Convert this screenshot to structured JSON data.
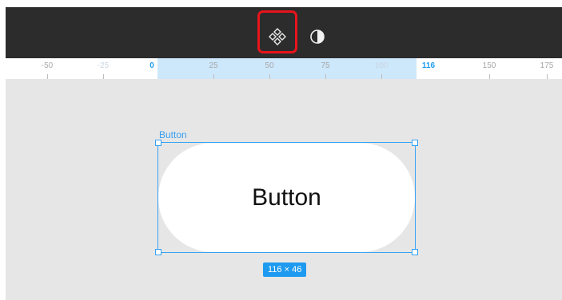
{
  "toolbar": {
    "components_icon": "components-diamond-icon",
    "theme_icon": "contrast-half-moon-icon"
  },
  "ruler": {
    "ticks": [
      "-50",
      "-25",
      "0",
      "25",
      "50",
      "75",
      "100",
      "116",
      "150",
      "175"
    ]
  },
  "canvas": {
    "layer_name": "Button",
    "button_label": "Button",
    "size_badge": "116 × 46"
  },
  "colors": {
    "toolbar_bg": "#2c2c2c",
    "canvas_bg": "#e6e6e6",
    "selection": "#35a2f4",
    "highlight": "#e8141b",
    "ruler_selection": "#cde7fb"
  }
}
